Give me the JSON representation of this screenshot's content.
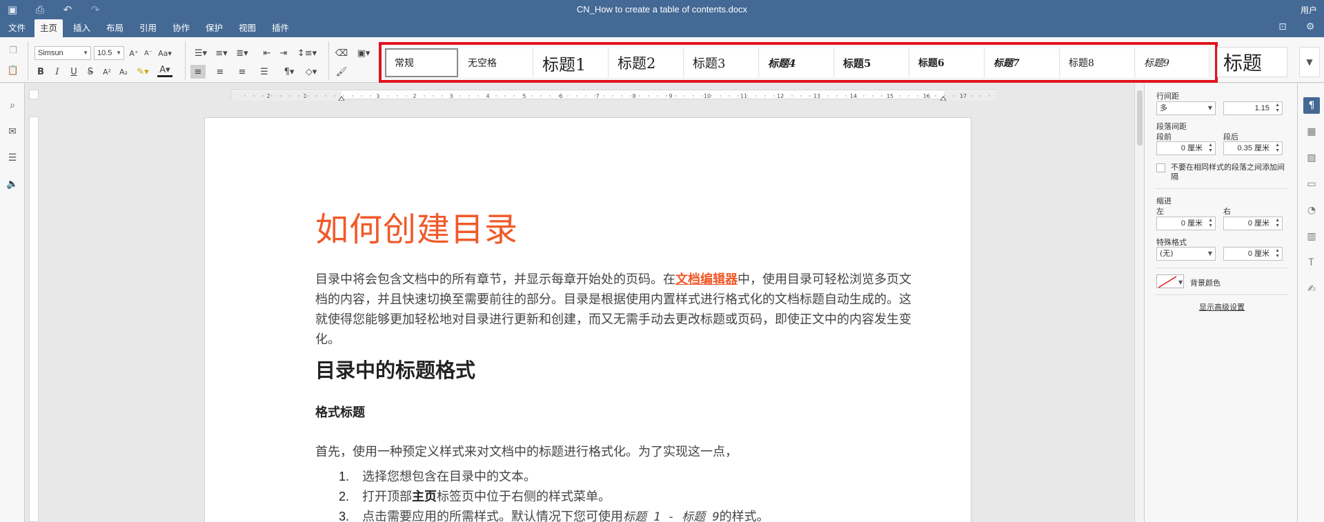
{
  "window": {
    "title": "CN_How to create a table of contents.docx",
    "user": "用户"
  },
  "menu": {
    "tabs": [
      "文件",
      "主页",
      "插入",
      "布局",
      "引用",
      "协作",
      "保护",
      "视图",
      "插件"
    ],
    "active": "主页"
  },
  "toolbar": {
    "font_name": "Simsun",
    "font_size": "10.5"
  },
  "styles": {
    "items": [
      "常规",
      "无空格",
      "标题1",
      "标题2",
      "标题3",
      "标题4",
      "标题5",
      "标题6",
      "标题7",
      "标题8",
      "标题9"
    ],
    "large_item": "标题",
    "selected": "常规"
  },
  "ruler": {
    "numbers": [
      "2",
      "1",
      "1",
      "2",
      "3",
      "4",
      "5",
      "6",
      "7",
      "8",
      "9",
      "10",
      "11",
      "12",
      "13",
      "14",
      "15",
      "16",
      "17"
    ]
  },
  "document": {
    "title": "如何创建目录",
    "intro_before_link": "目录中将会包含文档中的所有章节，并显示每章开始处的页码。在",
    "intro_link": "文档编辑器",
    "intro_after_link": "中，使用目录可轻松浏览多页文档的内容，并且快速切换至需要前往的部分。目录是根据使用内置样式进行格式化的文档标题自动生成的。这就使得您能够更加轻松地对目录进行更新和创建，而又无需手动去更改标题或页码，即使正文中的内容发生变化。",
    "heading_2": "目录中的标题格式",
    "heading_3": "格式标题",
    "paragraph": "首先，使用一种预定义样式来对文档中的标题进行格式化。为了实现这一点，",
    "list": [
      {
        "num": "1.",
        "text": "选择您想包含在目录中的文本。"
      },
      {
        "num": "2.",
        "before": "打开顶部",
        "bold": "主页",
        "after": "标签页中位于右侧的样式菜单。"
      },
      {
        "num": "3.",
        "before": "点击需要应用的所需样式。默认情况下您可使用",
        "italic": "标题 1 - 标题 9",
        "after": "的样式。"
      }
    ]
  },
  "paragraph_panel": {
    "line_spacing_label": "行间距",
    "line_spacing_mode": "多",
    "line_spacing_value": "1.15",
    "para_spacing_label": "段落间距",
    "before_label": "段前",
    "after_label": "段后",
    "before_value": "0 厘米",
    "after_value": "0.35 厘米",
    "no_space_label": "不要在相同样式的段落之间添加间隔",
    "indent_label": "缩进",
    "left_label": "左",
    "right_label": "右",
    "left_value": "0 厘米",
    "right_value": "0 厘米",
    "special_label": "特殊格式",
    "special_value": "(无)",
    "special_amount": "0 厘米",
    "bg_color_label": "背景颜色",
    "advanced_link": "显示高级设置"
  },
  "colors": {
    "header_bg": "#446995",
    "accent": "#f05a2a",
    "highlight_border": "#e3121e"
  }
}
